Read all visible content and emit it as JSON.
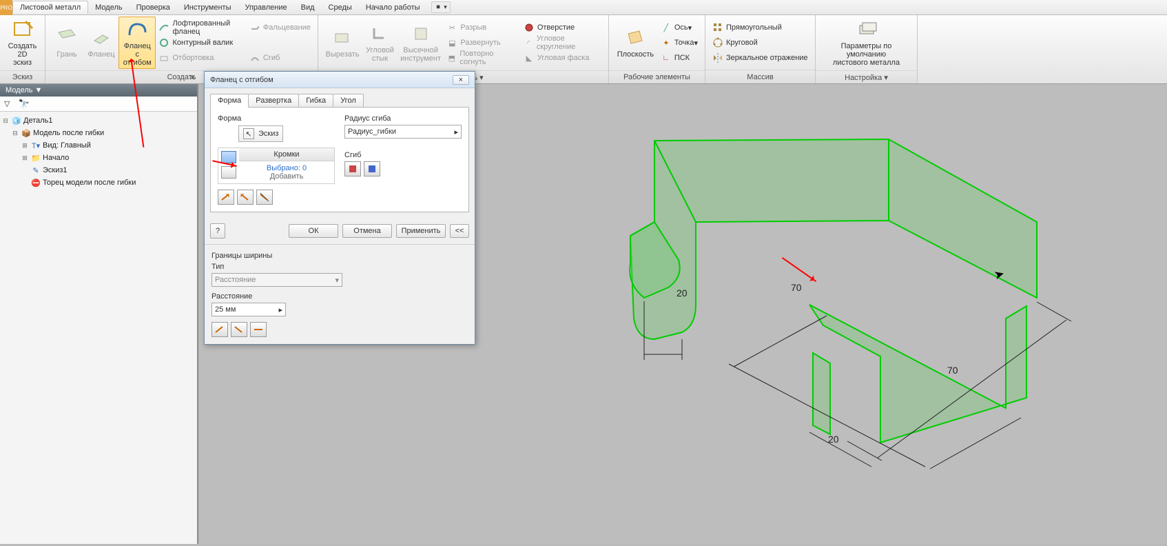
{
  "menubar": {
    "pro": "PRO",
    "tabs": [
      "Листовой металл",
      "Модель",
      "Проверка",
      "Инструменты",
      "Управление",
      "Вид",
      "Среды",
      "Начало работы"
    ],
    "active_index": 0
  },
  "ribbon": {
    "sketch": {
      "create2d": "Создать\n2D эскиз",
      "group": "Эскиз"
    },
    "create": {
      "face": "Грань",
      "flange": "Фланец",
      "contour_flange": "Фланец с\nотгибом",
      "lofted": "Лофтированный фланец",
      "contour_roll": "Контурный валик",
      "hem": "Фальцевание",
      "cutout": "Отбортовка",
      "bend": "Сгиб",
      "group": "Создать"
    },
    "modify_group": {
      "cut": "Вырезать",
      "corner": "Угловой\nстык",
      "punch": "Высечной\nинструмент",
      "rip": "Разрыв",
      "unfold": "Развернуть",
      "refold": "Повторно согнуть",
      "hole": "Отверстие",
      "round": "Угловое скругление",
      "chamfer": "Угловая фаска",
      "group": "Изменить ▾"
    },
    "work": {
      "plane": "Плоскость",
      "axis": "Ось",
      "point": "Точка",
      "ucs": "ПСК",
      "group": "Рабочие элементы"
    },
    "pattern": {
      "rect": "Прямоугольный",
      "circ": "Круговой",
      "mirror": "Зеркальное отражение",
      "group": "Массив"
    },
    "setup": {
      "defaults": "Параметры по умолчанию\nлистового металла",
      "group": "Настройка ▾"
    }
  },
  "left": {
    "header": "Модель ▼",
    "filter_icon": "filter",
    "binocular_icon": "find",
    "t0": "Деталь1",
    "t1": "Модель после гибки",
    "t2": "Вид: Главный",
    "t3": "Начало",
    "t4": "Эскиз1",
    "t5": "Торец модели после гибки"
  },
  "dialog": {
    "title": "Фланец с отгибом",
    "close": "×",
    "tabs": [
      "Форма",
      "Развертка",
      "Гибка",
      "Угол"
    ],
    "active_tab": 0,
    "shape_label": "Форма",
    "sketch_btn": "Эскиз",
    "edges_header": "Кромки",
    "selected": "Выбрано: 0",
    "add": "Добавить",
    "radius_label": "Радиус сгиба",
    "radius_value": "Радиус_гибки",
    "bend_label": "Сгиб",
    "ok": "ОК",
    "cancel": "Отмена",
    "apply": "Применить",
    "expand": "<<",
    "width_bounds": "Границы ширины",
    "type_label": "Тип",
    "type_value": "Расстояние",
    "distance_label": "Расстояние",
    "distance_value": "25 мм"
  },
  "dims": {
    "d1": "20",
    "d2": "70",
    "d3": "70",
    "d4": "20"
  }
}
